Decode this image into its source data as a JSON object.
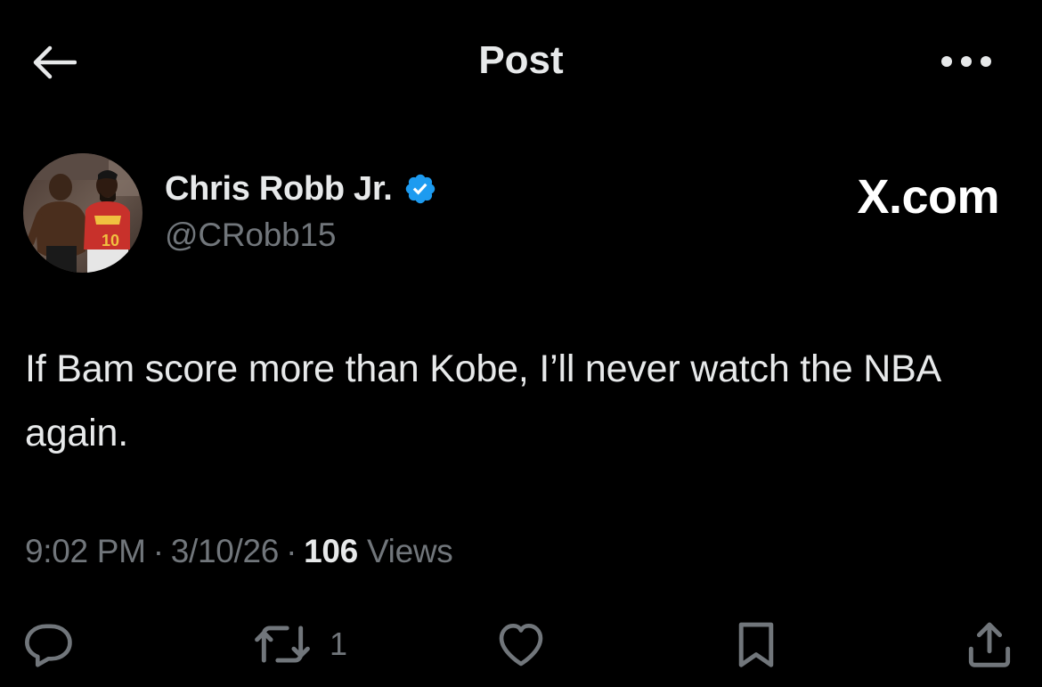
{
  "header": {
    "title": "Post",
    "back_icon": "arrow-left-icon",
    "more_icon": "more-horizontal-icon"
  },
  "author": {
    "display_name": "Chris Robb Jr.",
    "handle": "@CRobb15",
    "verified": true,
    "verified_color": "#1d9bf0",
    "avatar": "user-avatar-photo"
  },
  "watermark": "X.com",
  "post": {
    "text": "If Bam score more than Kobe, I’ll never watch the NBA again."
  },
  "meta": {
    "time": "9:02 PM",
    "date": "3/10/26",
    "separator": "·",
    "views_count": "106",
    "views_label": "Views"
  },
  "actions": {
    "reply": {
      "icon": "reply-icon",
      "count": ""
    },
    "repost": {
      "icon": "repost-icon",
      "count": "1"
    },
    "like": {
      "icon": "heart-icon",
      "count": ""
    },
    "bookmark": {
      "icon": "bookmark-icon",
      "count": ""
    },
    "share": {
      "icon": "share-icon",
      "count": ""
    }
  },
  "colors": {
    "background": "#000000",
    "text_primary": "#e7e9ea",
    "text_secondary": "#71767b",
    "accent": "#1d9bf0"
  }
}
